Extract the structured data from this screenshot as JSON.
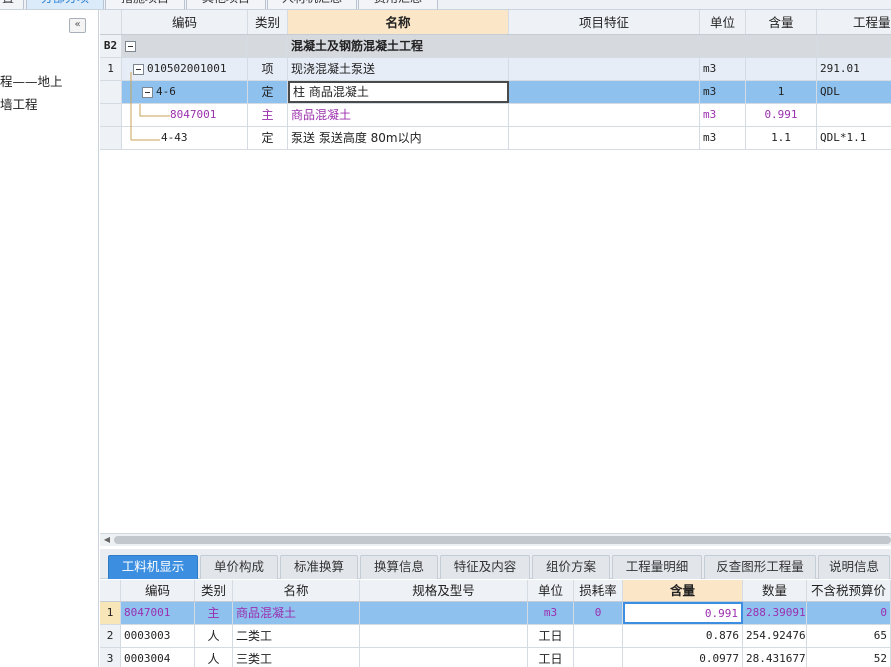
{
  "top_tabs": [
    "置",
    "分部分项",
    "措施项目",
    "其他项目",
    "人材机汇总",
    "费用汇总"
  ],
  "left_panel": {
    "collapse_glyph": "«",
    "tree_items": [
      "程——地上",
      "墙工程"
    ]
  },
  "upper_grid": {
    "columns": [
      "编码",
      "类别",
      "名称",
      "项目特征",
      "单位",
      "含量",
      "工程量"
    ],
    "rows": [
      {
        "row_label": "B2",
        "code": "",
        "type": "",
        "name": "混凝土及钢筋混凝土工程",
        "feature": "",
        "unit": "",
        "content": "",
        "quantity": ""
      },
      {
        "row_label": "1",
        "code": "010502001001",
        "type": "项",
        "name": "现浇混凝土泵送",
        "feature": "",
        "unit": "m3",
        "content": "",
        "quantity": "291.01"
      },
      {
        "row_label": "",
        "code": "4-6",
        "type": "定",
        "name": "柱 商品混凝土",
        "feature": "",
        "unit": "m3",
        "content": "1",
        "quantity": "QDL"
      },
      {
        "row_label": "",
        "code": "8047001",
        "type": "主",
        "name": "商品混凝土",
        "feature": "",
        "unit": "m3",
        "content": "0.991",
        "quantity": ""
      },
      {
        "row_label": "",
        "code": "4-43",
        "type": "定",
        "name": "泵送 泵送高度 80m以内",
        "feature": "",
        "unit": "m3",
        "content": "1.1",
        "quantity": "QDL*1.1"
      }
    ]
  },
  "lower_tabs": [
    "工料机显示",
    "单价构成",
    "标准换算",
    "换算信息",
    "特征及内容",
    "组价方案",
    "工程量明细",
    "反查图形工程量",
    "说明信息"
  ],
  "lower_grid": {
    "columns": [
      "编码",
      "类别",
      "名称",
      "规格及型号",
      "单位",
      "损耗率",
      "含量",
      "数量",
      "不含税预算价"
    ],
    "rows": [
      {
        "row_label": "1",
        "code": "8047001",
        "type": "主",
        "name": "商品混凝土",
        "spec": "",
        "unit": "m3",
        "loss": "0",
        "content": "0.991",
        "qty": "288.39091",
        "price": "0"
      },
      {
        "row_label": "2",
        "code": "0003003",
        "type": "人",
        "name": "二类工",
        "spec": "",
        "unit": "工日",
        "loss": "",
        "content": "0.876",
        "qty": "254.92476",
        "price": "65"
      },
      {
        "row_label": "3",
        "code": "0003004",
        "type": "人",
        "name": "三类工",
        "spec": "",
        "unit": "工日",
        "loss": "",
        "content": "0.0977",
        "qty": "28.431677",
        "price": "52"
      }
    ]
  },
  "colors": {
    "selected_row": "#8fc1ef",
    "active_tab": "#3c8fe0",
    "main_material": "#9b2fae",
    "header_highlight": "#fce6c8"
  }
}
